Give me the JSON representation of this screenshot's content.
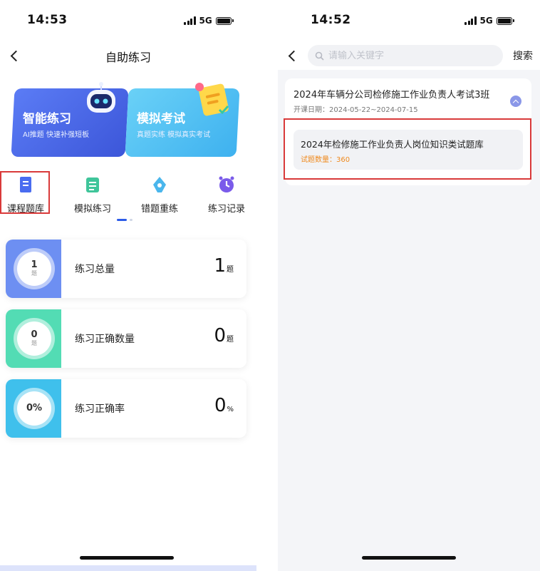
{
  "left_screen": {
    "status": {
      "time": "14:53",
      "network": "5G"
    },
    "nav": {
      "title": "自助练习"
    },
    "banners": {
      "smart": {
        "title": "智能练习",
        "subtitle": "AI推题 快速补强短板",
        "icon": "robot-icon"
      },
      "exam": {
        "title": "模拟考试",
        "subtitle": "真题实练 模拟真实考试",
        "icon": "memo-icon"
      }
    },
    "menu": [
      {
        "label": "课程题库",
        "icon": "book-icon",
        "color": "#4a6cf0",
        "highlighted": true
      },
      {
        "label": "模拟练习",
        "icon": "list-icon",
        "color": "#3fc59a"
      },
      {
        "label": "错题重练",
        "icon": "pen-icon",
        "color": "#4ab6ec"
      },
      {
        "label": "练习记录",
        "icon": "clock-icon",
        "color": "#7a5bea"
      }
    ],
    "stats": [
      {
        "label": "练习总量",
        "ring_value": "1",
        "ring_unit": "题",
        "value": "1",
        "unit": "题",
        "color": "#6d8ff2"
      },
      {
        "label": "练习正确数量",
        "ring_value": "0",
        "ring_unit": "题",
        "value": "0",
        "unit": "题",
        "color": "#53dcb4"
      },
      {
        "label": "练习正确率",
        "ring_value": "0%",
        "ring_unit": "",
        "value": "0",
        "unit": "%",
        "color": "#3fc0ec"
      }
    ]
  },
  "right_screen": {
    "status": {
      "time": "14:52",
      "network": "5G"
    },
    "search": {
      "placeholder": "请输入关键字",
      "button": "搜索"
    },
    "course": {
      "title": "2024年车辆分公司检修施工作业负责人考试3班",
      "date": "开课日期：2024-05-22~2024-07-15",
      "bank": {
        "title": "2024年检修施工作业负责人岗位知识类试题库",
        "count": "试题数量：360"
      }
    }
  },
  "colors": {
    "accent": "#2c5be8",
    "highlight": "#d93a3a",
    "count": "#f08a1e"
  }
}
